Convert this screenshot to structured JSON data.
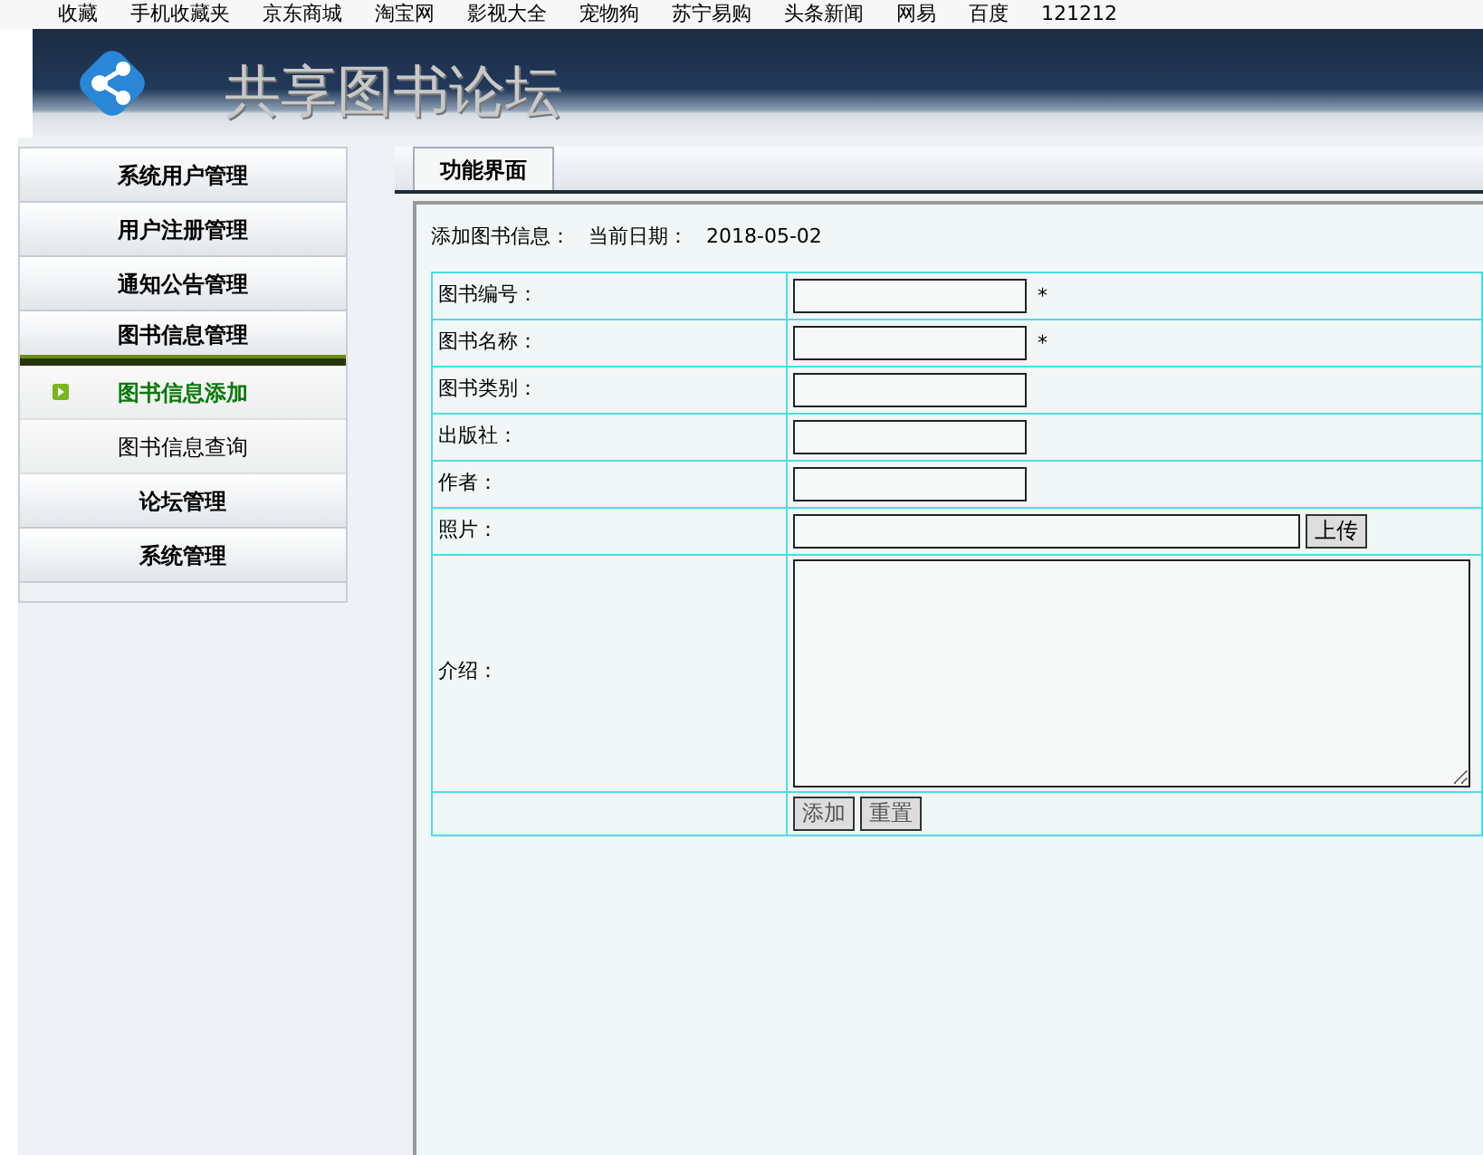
{
  "bookmarks": [
    {
      "label": "收藏"
    },
    {
      "label": "手机收藏夹"
    },
    {
      "label": "京东商城"
    },
    {
      "label": "淘宝网"
    },
    {
      "label": "影视大全"
    },
    {
      "label": "宠物狗"
    },
    {
      "label": "苏宁易购"
    },
    {
      "label": "头条新闻"
    },
    {
      "label": "网易"
    },
    {
      "label": "百度"
    },
    {
      "label": "121212"
    }
  ],
  "header": {
    "title": "共享图书论坛"
  },
  "sidebar": {
    "items": [
      {
        "label": "系统用户管理",
        "expanded": false
      },
      {
        "label": "用户注册管理",
        "expanded": false
      },
      {
        "label": "通知公告管理",
        "expanded": false
      },
      {
        "label": "图书信息管理",
        "expanded": true,
        "children": [
          {
            "label": "图书信息添加",
            "selected": true
          },
          {
            "label": "图书信息查询",
            "selected": false
          }
        ]
      },
      {
        "label": "论坛管理",
        "expanded": false
      },
      {
        "label": "系统管理",
        "expanded": false
      }
    ]
  },
  "tabs": [
    {
      "label": "功能界面",
      "selected": true
    }
  ],
  "form": {
    "heading": "添加图书信息：",
    "date_label": "当前日期：",
    "date": "2018-05-02",
    "fields": [
      {
        "kind": "text",
        "label": "图书编号：",
        "required_mark": "*"
      },
      {
        "kind": "text",
        "label": "图书名称：",
        "required_mark": "*"
      },
      {
        "kind": "text",
        "label": "图书类别："
      },
      {
        "kind": "text",
        "label": "出版社："
      },
      {
        "kind": "text",
        "label": "作者："
      },
      {
        "kind": "file",
        "label": "照片：",
        "button": "上传"
      },
      {
        "kind": "textarea",
        "label": "介绍："
      }
    ],
    "buttons": [
      "添加",
      "重置"
    ]
  }
}
